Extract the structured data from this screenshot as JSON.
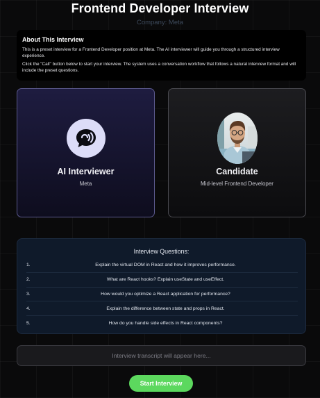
{
  "header": {
    "title": "Frontend Developer Interview",
    "company": "Company: Meta"
  },
  "about": {
    "heading": "About This Interview",
    "paragraph1": "This is a preset interview for a Frontend Developer position at Meta. The AI interviewer will guide you through a structured interview experience.",
    "paragraph2": "Click the \"Call\" button below to start your interview. The system uses a conversation workflow that follows a natural interview format and will include the preset questions."
  },
  "interviewer": {
    "name": "AI Interviewer",
    "role": "Meta",
    "icon": "chat-bubble-icon"
  },
  "candidate": {
    "name": "Candidate",
    "role": "Mid-level Frontend Developer"
  },
  "questions": {
    "heading": "Interview Questions:",
    "items": [
      {
        "num": "1.",
        "text": "Explain the virtual DOM in React and how it improves performance."
      },
      {
        "num": "2.",
        "text": "What are React hooks? Explain useState and useEffect."
      },
      {
        "num": "3.",
        "text": "How would you optimize a React application for performance?"
      },
      {
        "num": "4.",
        "text": "Explain the difference between state and props in React."
      },
      {
        "num": "5.",
        "text": "How do you handle side effects in React components?"
      }
    ]
  },
  "transcript": {
    "placeholder": "Interview transcript will appear here..."
  },
  "actions": {
    "start_label": "Start Interview"
  },
  "colors": {
    "accent_green": "#5cd85e",
    "ai_card_border": "#5c5a8e",
    "ai_avatar_bg": "#dcdcf8"
  }
}
